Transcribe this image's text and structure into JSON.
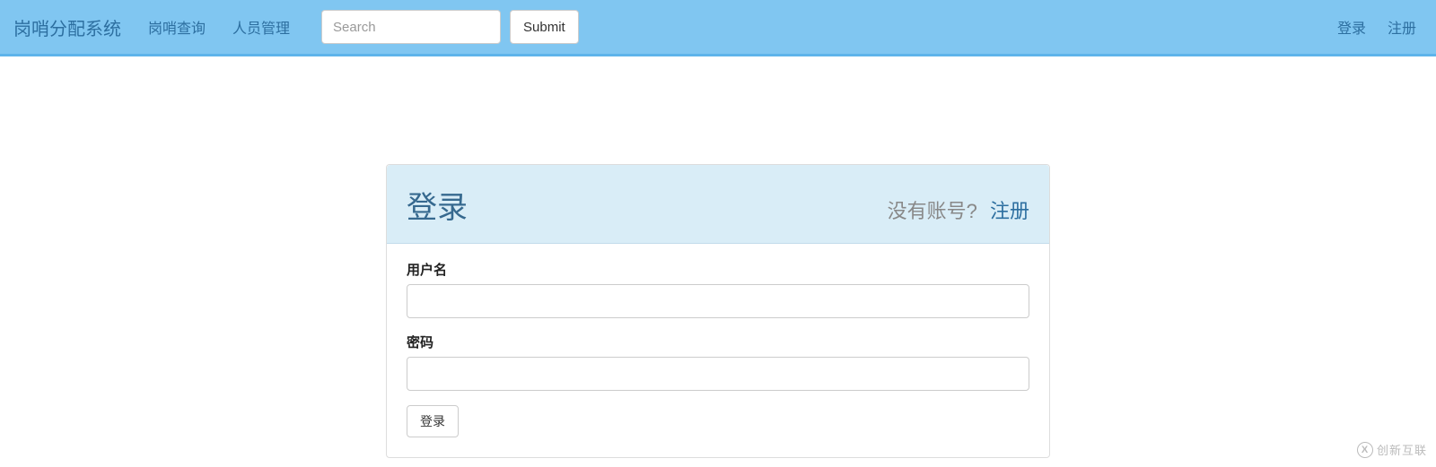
{
  "navbar": {
    "brand": "岗哨分配系统",
    "links": [
      {
        "label": "岗哨查询"
      },
      {
        "label": "人员管理"
      }
    ],
    "search_placeholder": "Search",
    "submit_label": "Submit",
    "right_links": [
      {
        "label": "登录"
      },
      {
        "label": "注册"
      }
    ]
  },
  "login_panel": {
    "title": "登录",
    "no_account_text": "没有账号?",
    "register_link": "注册",
    "username_label": "用户名",
    "password_label": "密码",
    "login_button": "登录"
  },
  "watermark": {
    "text": "创新互联"
  }
}
